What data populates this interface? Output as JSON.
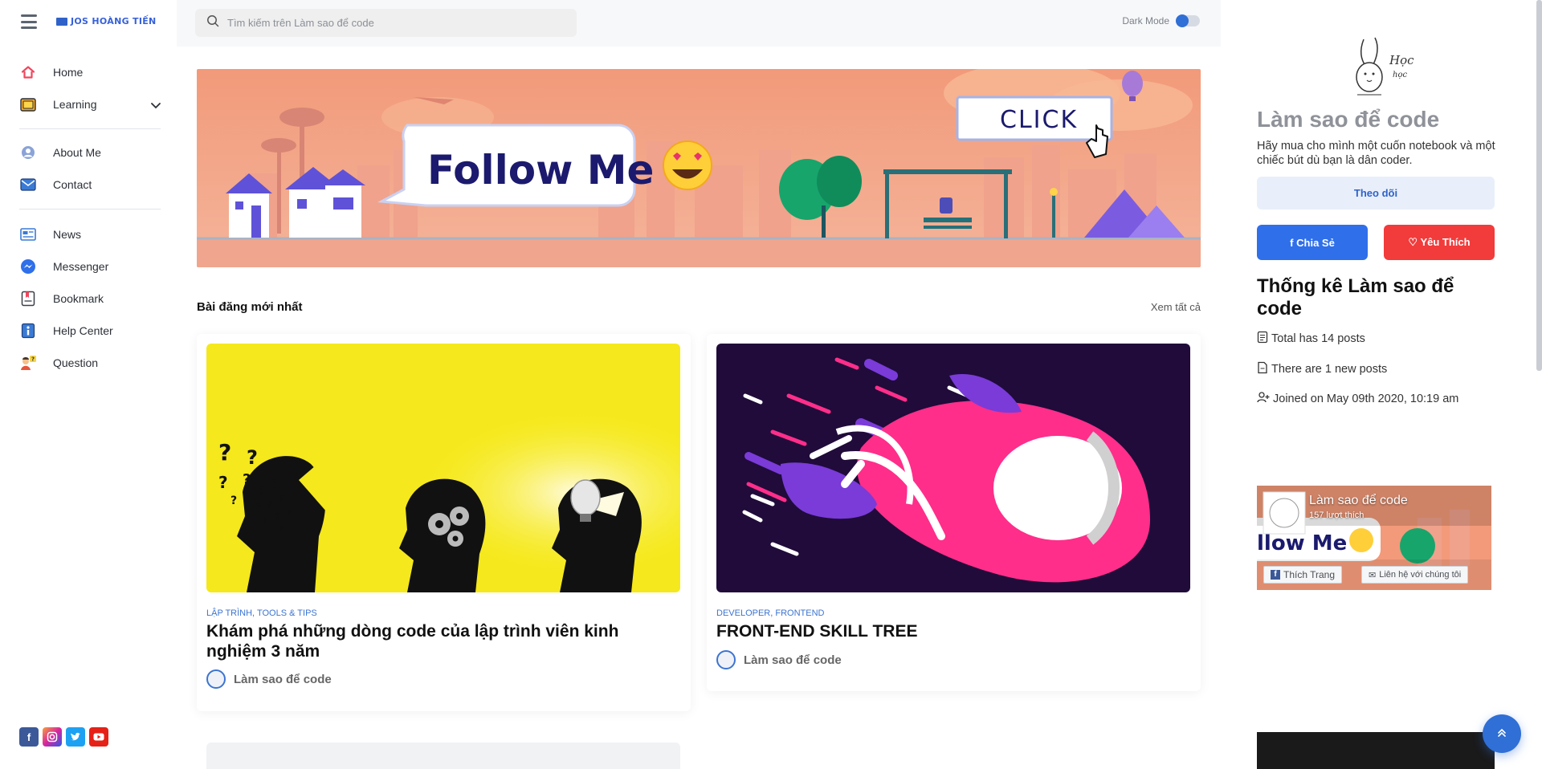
{
  "app": {
    "brand_name": "JOS HOÀNG TIẾN"
  },
  "sidebar": {
    "items": [
      {
        "label": "Home",
        "icon": "home-icon"
      },
      {
        "label": "Learning",
        "icon": "folder-icon"
      },
      {
        "label": "About Me",
        "icon": "user-icon"
      },
      {
        "label": "Contact",
        "icon": "mail-icon"
      },
      {
        "label": "News",
        "icon": "news-icon"
      },
      {
        "label": "Messenger",
        "icon": "messenger-icon"
      },
      {
        "label": "Bookmark",
        "icon": "bookmark-icon"
      },
      {
        "label": "Help Center",
        "icon": "info-icon"
      },
      {
        "label": "Question",
        "icon": "question-icon"
      }
    ],
    "social": [
      "facebook-icon",
      "instagram-icon",
      "twitter-icon",
      "youtube-icon"
    ]
  },
  "topbar": {
    "search_placeholder": "Tìm kiếm trên Làm sao để code",
    "dark_mode_label": "Dark Mode"
  },
  "banner": {
    "follow_text": "Follow Me",
    "click_text": "CLICK"
  },
  "main": {
    "section_title": "Bài đăng mới nhất",
    "see_all": "Xem tất cả",
    "posts": [
      {
        "category": "LẬP TRÌNH, TOOLS & TIPS",
        "title": "Khám phá những dòng code của lập trình viên kinh nghiệm 3 năm",
        "author": "Làm sao để code"
      },
      {
        "category": "DEVELOPER, FRONTEND",
        "title": "FRONT-END SKILL TREE",
        "author": "Làm sao để code"
      }
    ]
  },
  "right": {
    "mascot_text_1": "Học",
    "mascot_text_2": "học",
    "site_name": "Làm sao để code",
    "tagline": "Hãy mua cho mình một cuốn notebook và một chiếc bút dù bạn là dân coder.",
    "follow_label": "Theo dõi",
    "share_label": "Chia Sẻ",
    "love_label": "Yêu Thích",
    "stats_title": "Thống kê Làm sao để code",
    "stats": [
      "Total has 14 posts",
      "There are 1 new posts",
      "Joined on May 09th 2020, 10:19 am"
    ],
    "fb_page_name": "Làm sao để code",
    "fb_likes": "157 lượt thích",
    "fb_banner_text": "llow Me",
    "fb_like_button": "Thích Trang",
    "fb_contact_button": "Liên hệ với chúng tôi"
  },
  "colors": {
    "accent": "#2f6fd6",
    "brand_blue": "#3761d9",
    "love_red": "#f23b3b",
    "banner_bg": "#f0a084",
    "follow_text": "#1b1a6e"
  }
}
